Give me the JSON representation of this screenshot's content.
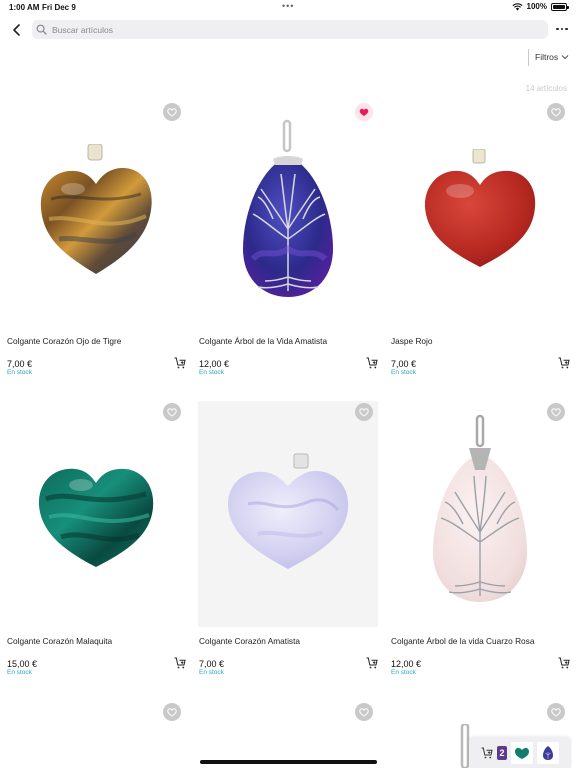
{
  "status_bar": {
    "time": "1:00 AM",
    "date": "Fri Dec 9",
    "dots": "•••",
    "battery": "100%",
    "battery_level": 1.0
  },
  "header": {
    "back_icon": "chevron-left-icon",
    "search_icon": "search-icon",
    "search_placeholder": "Buscar artículos",
    "more_icon": "ellipsis-icon"
  },
  "filter": {
    "label": "Filtros",
    "icon": "chevron-down-icon"
  },
  "item_count": "14 artículos",
  "colors": {
    "stock_text": "#27a7c8",
    "favorite_active": "#e8195c",
    "cart_badge": "#5b3b8c"
  },
  "products": [
    {
      "name": "Colgante Corazón Ojo de Tigre",
      "price": "7,00 €",
      "stock": "En stock",
      "favorite": false,
      "stone": "tiger-eye-heart"
    },
    {
      "name": "Colgante Árbol de la Vida Amatista",
      "price": "12,00 €",
      "stock": "En stock",
      "favorite": true,
      "stone": "amethyst-tree-of-life-drop"
    },
    {
      "name": "Jaspe Rojo",
      "price": "7,00 €",
      "stock": "En stock",
      "favorite": false,
      "stone": "red-jasper-heart"
    },
    {
      "name": "Colgante Corazón Malaquita",
      "price": "15,00 €",
      "stock": "En stock",
      "favorite": false,
      "stone": "malachite-heart"
    },
    {
      "name": "Colgante Corazón Amatista",
      "price": "7,00 €",
      "stock": "En stock",
      "favorite": false,
      "stone": "amethyst-heart"
    },
    {
      "name": "Colgante Árbol de la vida Cuarzo Rosa",
      "price": "12,00 €",
      "stock": "En stock",
      "favorite": false,
      "stone": "rose-quartz-tree-of-life-drop"
    },
    {
      "favorite": false,
      "stone": "partial-row"
    },
    {
      "favorite": false,
      "stone": "partial-row"
    },
    {
      "favorite": false,
      "stone": "partial-row"
    }
  ],
  "mini_cart": {
    "icon": "cart-icon",
    "count": "2"
  }
}
